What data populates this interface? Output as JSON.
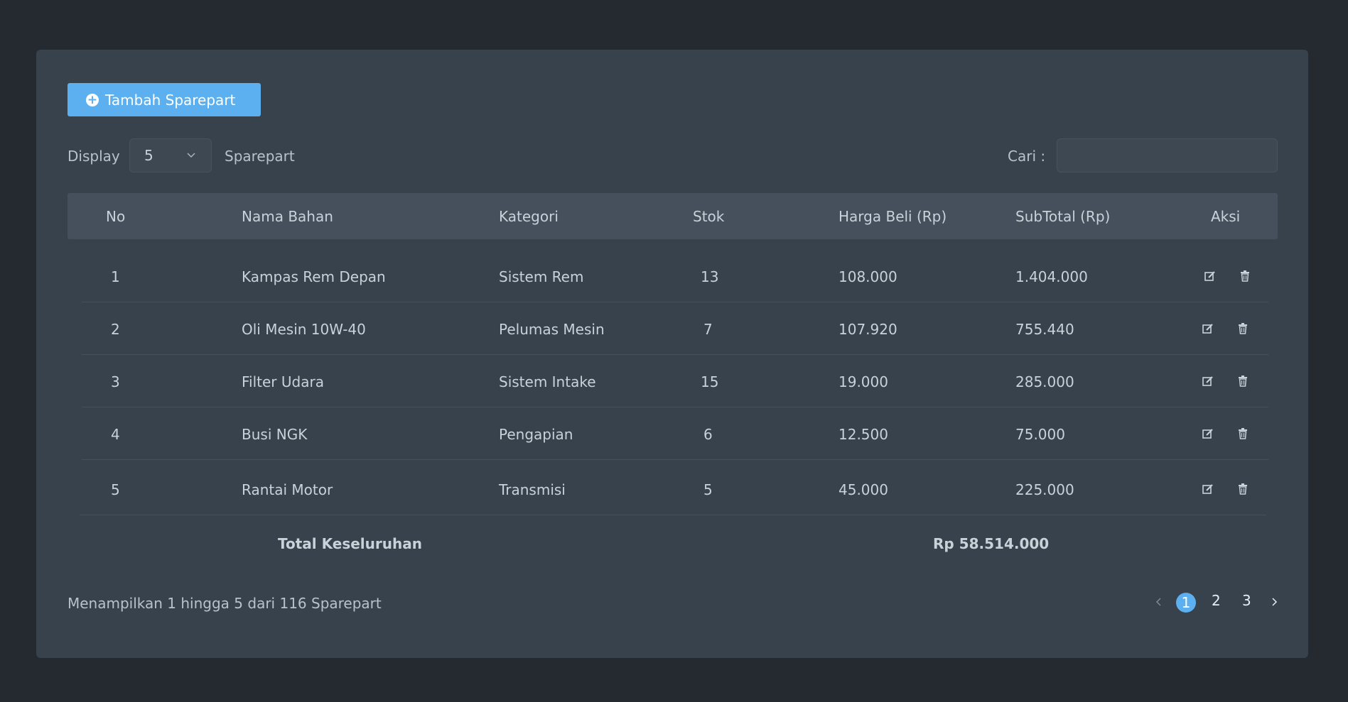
{
  "toolbar": {
    "add_label": "Tambah Sparepart",
    "display_label": "Display",
    "display_value": "5",
    "sparepart_label": "Sparepart",
    "search_label": "Cari :",
    "search_value": ""
  },
  "table": {
    "headers": [
      "No",
      "Nama Bahan",
      "Kategori",
      "Stok",
      "Harga Beli (Rp)",
      "SubTotal (Rp)",
      "Aksi"
    ],
    "rows": [
      {
        "no": "1",
        "nama": "Kampas Rem Depan",
        "kategori": "Sistem Rem",
        "stok": "13",
        "harga": "108.000",
        "subtotal": "1.404.000"
      },
      {
        "no": "2",
        "nama": "Oli Mesin 10W-40",
        "kategori": "Pelumas Mesin",
        "stok": "7",
        "harga": "107.920",
        "subtotal": "755.440"
      },
      {
        "no": "3",
        "nama": "Filter Udara",
        "kategori": "Sistem Intake",
        "stok": "15",
        "harga": "19.000",
        "subtotal": "285.000"
      },
      {
        "no": "4",
        "nama": "Busi NGK",
        "kategori": "Pengapian",
        "stok": "6",
        "harga": "12.500",
        "subtotal": "75.000"
      },
      {
        "no": "5",
        "nama": "Rantai Motor",
        "kategori": "Transmisi",
        "stok": "5",
        "harga": "45.000",
        "subtotal": "225.000"
      }
    ],
    "total_label": "Total Keseluruhan",
    "total_value": "Rp 58.514.000"
  },
  "footer": {
    "info": "Menampilkan 1 hingga 5 dari 116 Sparepart",
    "pages": [
      "1",
      "2",
      "3"
    ],
    "active_page": "1"
  },
  "icons": {
    "edit": "edit-icon",
    "delete": "trash-icon",
    "add": "plus-circle-icon",
    "prev": "chevron-left-icon",
    "next": "chevron-right-icon",
    "dropdown": "chevron-down-icon"
  },
  "colors": {
    "accent": "#5cb0f0",
    "background": "#252a31",
    "card": "#37424d",
    "header": "#46505c"
  }
}
